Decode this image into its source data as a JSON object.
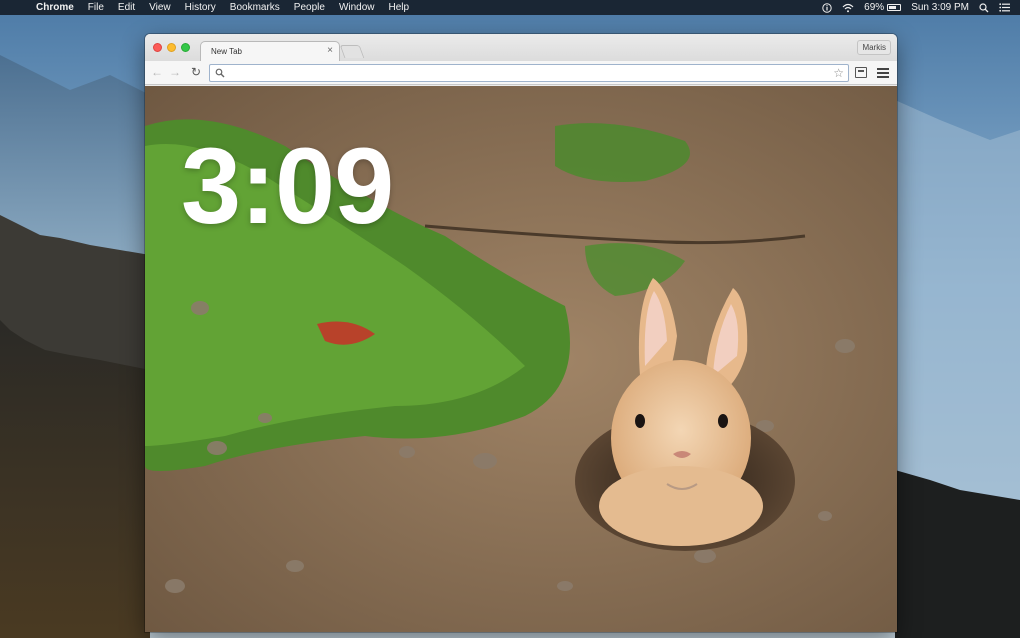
{
  "menubar": {
    "apple_icon": "apple-icon",
    "items": [
      "Chrome",
      "File",
      "Edit",
      "View",
      "History",
      "Bookmarks",
      "People",
      "Window",
      "Help"
    ],
    "status": {
      "battery_percent": "69%",
      "battery_level": 0.69,
      "datetime": "Sun 3:09 PM",
      "icons": [
        "info-icon",
        "wifi-icon",
        "battery-icon",
        "spotlight-icon",
        "notification-center-icon"
      ]
    }
  },
  "browser": {
    "tab": {
      "title": "New Tab",
      "close": "×"
    },
    "profile": "Markis",
    "toolbar": {
      "back": "←",
      "forward": "→",
      "reload": "↻",
      "omnibox_value": "",
      "star": "☆"
    }
  },
  "page": {
    "clock": "3:09"
  },
  "colors": {
    "menubar": "#161e2a",
    "traffic_red": "#fc5b57",
    "traffic_yellow": "#fdbc2e",
    "traffic_green": "#33c748",
    "clock_text": "#ffffff"
  }
}
